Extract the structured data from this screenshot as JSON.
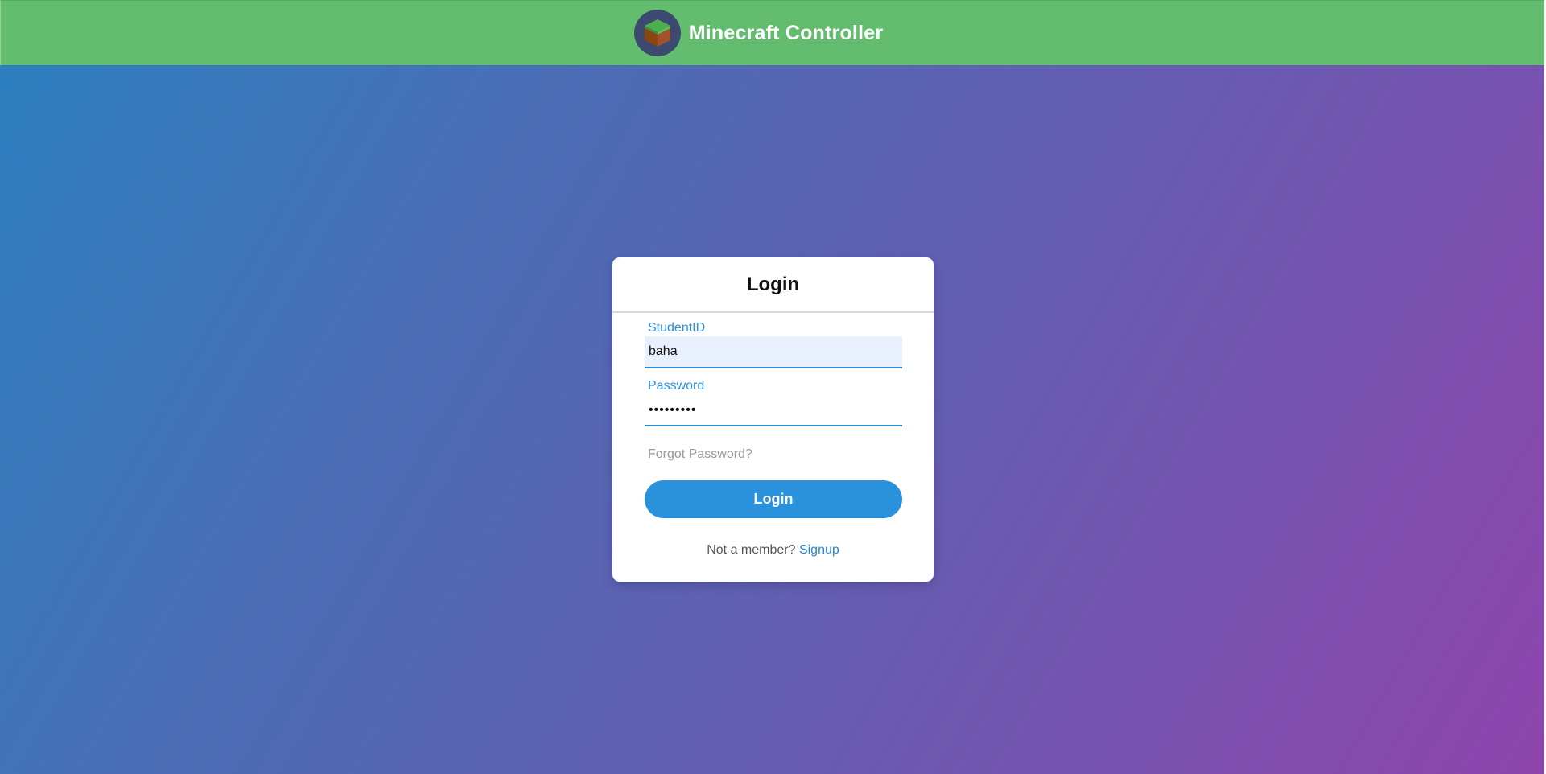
{
  "header": {
    "title": "Minecraft Controller",
    "logo_icon": "grass-block-icon"
  },
  "login": {
    "title": "Login",
    "student_id_label": "StudentID",
    "student_id_value": "baha",
    "password_label": "Password",
    "password_value": "•••••••••",
    "forgot_password": "Forgot Password?",
    "login_button": "Login",
    "not_member_text": "Not a member?",
    "signup_link": "Signup"
  },
  "colors": {
    "header_bg": "#62bd6e",
    "accent": "#2a91dc",
    "gradient_start": "#2a80bf",
    "gradient_end": "#8e44ad"
  }
}
